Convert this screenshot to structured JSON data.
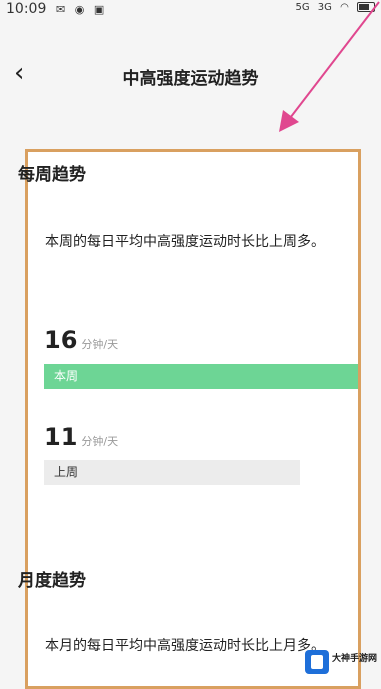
{
  "status_bar": {
    "time": "10:09",
    "left_icons": [
      "message-icon",
      "eye-icon",
      "app-icon"
    ],
    "network": "5G",
    "signal": "3G"
  },
  "nav": {
    "back_icon": "chevron-left-icon",
    "title": "中高强度运动趋势"
  },
  "weekly": {
    "title": "每周趋势",
    "description": "本周的每日平均中高强度运动时长比上周多。",
    "this_week": {
      "value": "16",
      "unit": "分钟/天",
      "label": "本周"
    },
    "last_week": {
      "value": "11",
      "unit": "分钟/天",
      "label": "上周"
    }
  },
  "monthly": {
    "title": "月度趋势",
    "description": "本月的每日平均中高强度运动时长比上月多。"
  },
  "watermark": {
    "name": "大神手游网"
  },
  "colors": {
    "annotation_frame": "#d9a060",
    "annotation_arrow": "#e0478f",
    "this_week_bar": "#6dd595",
    "last_week_bar": "#ececec"
  }
}
